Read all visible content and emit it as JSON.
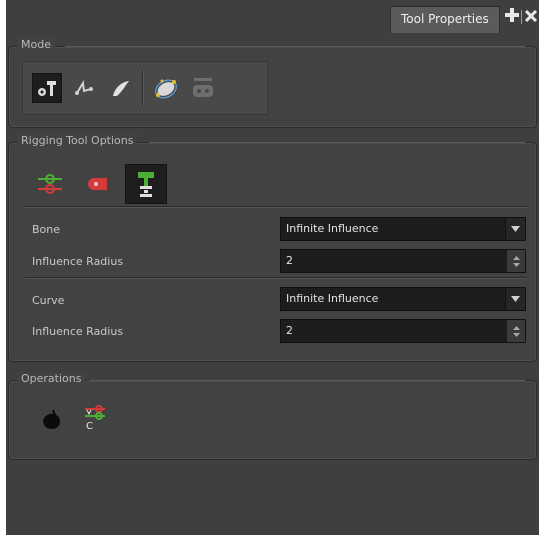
{
  "panel_tab": {
    "title": "Tool Properties",
    "add_icon": "plus-icon",
    "close_icon": "close-icon"
  },
  "mode": {
    "title": "Mode",
    "tools": [
      {
        "icon": "rigging-hammer-icon",
        "selected": true
      },
      {
        "icon": "ik-bone-icon"
      },
      {
        "icon": "curve-brush-icon"
      },
      {
        "icon": "envelope-deformer-icon"
      },
      {
        "icon": "game-rig-icon"
      }
    ]
  },
  "rigging": {
    "title": "Rigging Tool Options",
    "buttons": [
      {
        "icon": "bone-chain-icon"
      },
      {
        "icon": "curve-deformer-icon"
      },
      {
        "icon": "envelope-rig-icon",
        "selected": true
      }
    ],
    "bone_label": "Bone",
    "bone_value": "Infinite Influence",
    "bone_radius_label": "Influence Radius",
    "bone_radius_value": "2",
    "curve_label": "Curve",
    "curve_value": "Infinite Influence",
    "curve_radius_label": "Influence Radius",
    "curve_radius_value": "2"
  },
  "operations": {
    "title": "Operations",
    "buttons": [
      {
        "icon": "convert-to-drawing-icon"
      },
      {
        "icon": "set-rest-curve-icon"
      }
    ]
  },
  "colors": {
    "panel": "#3f3f3f",
    "field": "#1d1d1d",
    "accent_green": "#4caf34",
    "accent_red": "#d43a3a"
  }
}
